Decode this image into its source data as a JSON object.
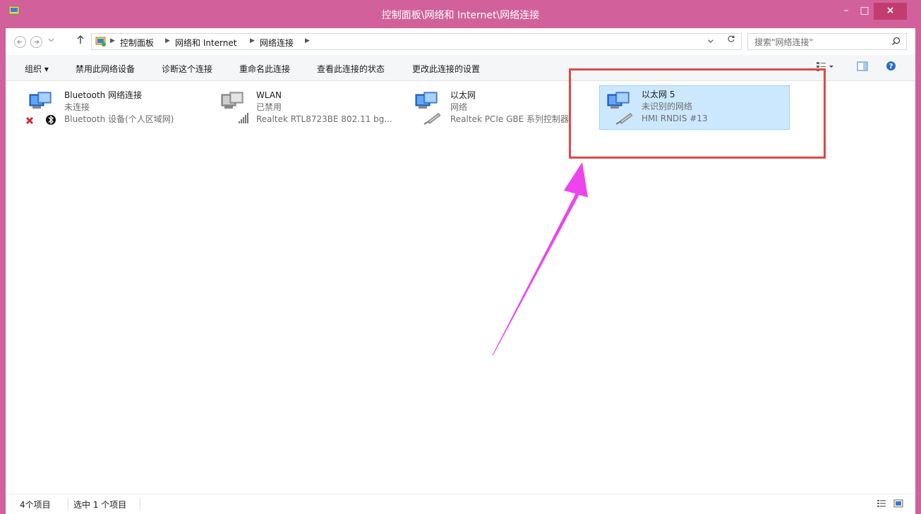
{
  "window": {
    "title": "控制面板\\网络和 Internet\\网络连接",
    "minimize_glyph": "–",
    "maximize_glyph": "□",
    "close_glyph": "×"
  },
  "address": {
    "breadcrumbs": [
      "控制面板",
      "网络和 Internet",
      "网络连接"
    ],
    "search_placeholder": "搜索\"网络连接\""
  },
  "toolbar": {
    "organize": "组织 ▾",
    "commands": [
      "禁用此网络设备",
      "诊断这个连接",
      "重命名此连接",
      "查看此连接的状态",
      "更改此连接的设置"
    ]
  },
  "connections": [
    {
      "name": "Bluetooth 网络连接",
      "status": "未连接",
      "device": "Bluetooth 设备(个人区域网)",
      "icon": "bluetooth-connection-icon",
      "selected": false
    },
    {
      "name": "WLAN",
      "status": "已禁用",
      "device": "Realtek RTL8723BE 802.11 bg...",
      "icon": "wlan-connection-icon",
      "selected": false
    },
    {
      "name": "以太网",
      "status": "网络",
      "device": "Realtek PCIe GBE 系列控制器",
      "icon": "ethernet-connection-icon",
      "selected": false
    },
    {
      "name": "以太网 5",
      "status": "未识别的网络",
      "device": "HMI RNDIS #13",
      "icon": "ethernet-connection-icon",
      "selected": true
    }
  ],
  "status": {
    "item_count": "4个项目",
    "selected_count": "选中 1 个项目"
  },
  "colors": {
    "window_frame": "#d2619b",
    "selection_fill": "#cce8ff",
    "selection_border": "#99d1ff",
    "highlight_box": "#e04848",
    "arrow": "#ee44ee"
  }
}
